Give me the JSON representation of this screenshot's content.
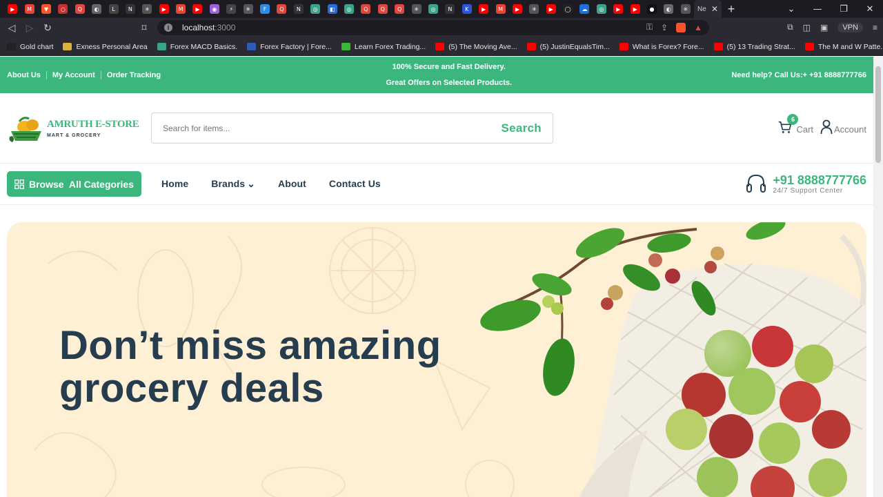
{
  "browser": {
    "active_tab_label": "Ne",
    "url_host": "localhost",
    "url_port": ":3000",
    "vpn_label": "VPN",
    "new_tab": "+"
  },
  "tab_favicons": [
    {
      "color": "#ff0000",
      "glyph": "▶"
    },
    {
      "color": "#ea4335",
      "glyph": "M"
    },
    {
      "color": "#fb542b",
      "glyph": "▼"
    },
    {
      "color": "#c53030",
      "glyph": "○"
    },
    {
      "color": "#e0463d",
      "glyph": "Q"
    },
    {
      "color": "#666666",
      "glyph": "◐"
    },
    {
      "color": "#444444",
      "glyph": "L"
    },
    {
      "color": "#333333",
      "glyph": "N"
    },
    {
      "color": "#555555",
      "glyph": "✳"
    },
    {
      "color": "#ff0000",
      "glyph": "▶"
    },
    {
      "color": "#ea4335",
      "glyph": "M"
    },
    {
      "color": "#ff0000",
      "glyph": "▶"
    },
    {
      "color": "#9f5fd6",
      "glyph": "◉"
    },
    {
      "color": "#444444",
      "glyph": "⚡"
    },
    {
      "color": "#555555",
      "glyph": "✳"
    },
    {
      "color": "#2b8be8",
      "glyph": "F"
    },
    {
      "color": "#e0463d",
      "glyph": "Q"
    },
    {
      "color": "#333333",
      "glyph": "N"
    },
    {
      "color": "#3aa38a",
      "glyph": "◎"
    },
    {
      "color": "#2a6ad6",
      "glyph": "◧"
    },
    {
      "color": "#3aa38a",
      "glyph": "◎"
    },
    {
      "color": "#e0463d",
      "glyph": "Q"
    },
    {
      "color": "#e0463d",
      "glyph": "Q"
    },
    {
      "color": "#e0463d",
      "glyph": "Q"
    },
    {
      "color": "#555555",
      "glyph": "✳"
    },
    {
      "color": "#3aa38a",
      "glyph": "◎"
    },
    {
      "color": "#333333",
      "glyph": "N"
    },
    {
      "color": "#2a56d6",
      "glyph": "K"
    },
    {
      "color": "#ff0000",
      "glyph": "▶"
    },
    {
      "color": "#ea4335",
      "glyph": "M"
    },
    {
      "color": "#ff0000",
      "glyph": "▶"
    },
    {
      "color": "#555555",
      "glyph": "✳"
    },
    {
      "color": "#ff0000",
      "glyph": "▶"
    },
    {
      "color": "#222222",
      "glyph": "◯"
    },
    {
      "color": "#1e6fd9",
      "glyph": "☁"
    },
    {
      "color": "#3aa38a",
      "glyph": "◎"
    },
    {
      "color": "#ff0000",
      "glyph": "▶"
    },
    {
      "color": "#ff0000",
      "glyph": "▶"
    },
    {
      "color": "#111111",
      "glyph": "●"
    },
    {
      "color": "#666666",
      "glyph": "◐"
    },
    {
      "color": "#555555",
      "glyph": "✳"
    }
  ],
  "bookmarks": [
    {
      "label": "Gold chart",
      "color": "#222222"
    },
    {
      "label": "Exness Personal Area",
      "color": "#d9b13b"
    },
    {
      "label": "Forex MACD Basics.",
      "color": "#3aa38a"
    },
    {
      "label": "Forex Factory | Fore...",
      "color": "#2e5cb8"
    },
    {
      "label": "Learn Forex Trading...",
      "color": "#38b834"
    },
    {
      "label": "(5) The Moving Ave...",
      "color": "#ff0000"
    },
    {
      "label": "(5) JustinEqualsTim...",
      "color": "#ff0000"
    },
    {
      "label": "What is Forex? Fore...",
      "color": "#ff0000"
    },
    {
      "label": "(5) 13 Trading Strat...",
      "color": "#ff0000"
    },
    {
      "label": "The M and W Patte...",
      "color": "#ff0000"
    }
  ],
  "topbar": {
    "links": [
      "About Us",
      "My Account",
      "Order Tracking"
    ],
    "message_1": "100% Secure and Fast Delivery.",
    "message_2": "Great Offers on Selected Products.",
    "help": "Need help? Call Us:+ +91 8888777766"
  },
  "header": {
    "logo_title": "AMRUTH E-STORE",
    "logo_sub": "MART & GROCERY",
    "search_placeholder": "Search for items...",
    "search_button": "Search",
    "cart_label": "Cart",
    "cart_count": "6",
    "account_label": "Account"
  },
  "nav": {
    "browse_label": "Browse  All Categories",
    "items": [
      "Home",
      "Brands",
      "About",
      "Contact Us"
    ],
    "support_phone": "+91 8888777766",
    "support_sub": "24/7 Support Center"
  },
  "hero": {
    "line_1": "Don’t miss amazing",
    "line_2": "grocery deals"
  },
  "colors": {
    "brand_green": "#3bb77e",
    "heading_dark": "#253d4e",
    "hero_bg": "#fdf0d5"
  }
}
